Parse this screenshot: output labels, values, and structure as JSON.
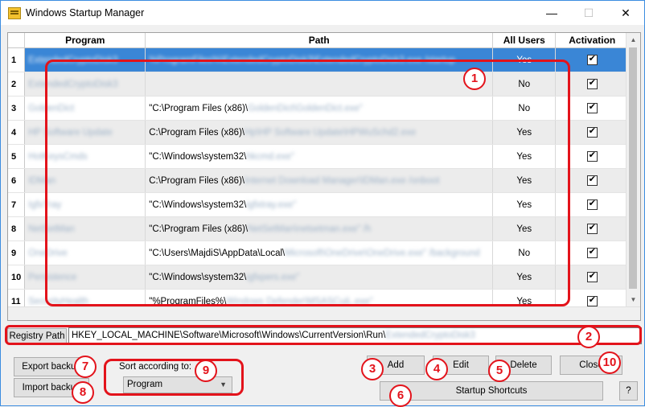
{
  "window": {
    "title": "Windows Startup Manager",
    "minimize": "—",
    "maximize": "☐",
    "close": "✕"
  },
  "table": {
    "columns": [
      "Program",
      "Path",
      "All Users",
      "Activation"
    ],
    "rows": [
      {
        "num": "1",
        "program": "ExtendedCryptoDisk3",
        "path": "%ProgramFiles%\\ExtendedCryptoDisk3\\ExtendedCryptoDisk3.exe /startup",
        "all_users": "Yes",
        "activation": true
      },
      {
        "num": "2",
        "program": "ExtendedCryptoDisk3",
        "path": "",
        "all_users": "No",
        "activation": true
      },
      {
        "num": "3",
        "program": "GoldenDict",
        "path_prefix": "\"C:\\Program Files (x86)\\",
        "path_rest": "GoldenDict\\GoldenDict.exe\"",
        "all_users": "No",
        "activation": true
      },
      {
        "num": "4",
        "program": "HP Software Update",
        "path_prefix": "C:\\Program Files (x86)\\",
        "path_rest": "Hp\\HP Software Update\\HPWuSchd2.exe",
        "all_users": "Yes",
        "activation": true
      },
      {
        "num": "5",
        "program": "HotKeysCmds",
        "path_prefix": "\"C:\\Windows\\system32\\",
        "path_rest": "hkcmd.exe\"",
        "all_users": "Yes",
        "activation": true
      },
      {
        "num": "6",
        "program": "IDMan",
        "path_prefix": "C:\\Program Files (x86)\\",
        "path_rest": "Internet Download Manager\\IDMan.exe /onboot",
        "all_users": "Yes",
        "activation": true
      },
      {
        "num": "7",
        "program": "IgfxTray",
        "path_prefix": "\"C:\\Windows\\system32\\",
        "path_rest": "igfxtray.exe\"",
        "all_users": "Yes",
        "activation": true
      },
      {
        "num": "8",
        "program": "NetSetMan",
        "path_prefix": "\"C:\\Program Files (x86)\\",
        "path_rest": "NetSetMan\\netsetman.exe\" /h",
        "all_users": "Yes",
        "activation": true
      },
      {
        "num": "9",
        "program": "OneDrive",
        "path_prefix": "\"C:\\Users\\MajdiS\\AppData\\Local\\",
        "path_rest": "Microsoft\\OneDrive\\OneDrive.exe\" /background",
        "all_users": "No",
        "activation": true
      },
      {
        "num": "10",
        "program": "Persistence",
        "path_prefix": "\"C:\\Windows\\system32\\",
        "path_rest": "igfxpers.exe\"",
        "all_users": "Yes",
        "activation": true
      },
      {
        "num": "11",
        "program": "SecurityHealth",
        "path_prefix": "\"%ProgramFiles%\\",
        "path_rest": "Windows Defender\\MSASCuiL.exe\"",
        "all_users": "Yes",
        "activation": true
      }
    ]
  },
  "registry": {
    "label": "Registry Path",
    "value_prefix": "HKEY_LOCAL_MACHINE\\Software\\Microsoft\\Windows\\CurrentVersion\\Run\\",
    "value_rest": "ExtendedCryptoDisk3"
  },
  "buttons": {
    "export": "Export backup",
    "import": "Import backup",
    "add": "Add",
    "edit": "Edit",
    "delete": "Delete",
    "close": "Close",
    "startup_shortcuts": "Startup Shortcuts",
    "help": "?"
  },
  "sort": {
    "label": "Sort according to:",
    "selected": "Program"
  },
  "annotations": [
    "1",
    "2",
    "3",
    "4",
    "5",
    "6",
    "7",
    "8",
    "9",
    "10"
  ],
  "colors": {
    "selection": "#3a86d6",
    "annotation": "#e3131b",
    "border_active": "#3c8de0"
  }
}
